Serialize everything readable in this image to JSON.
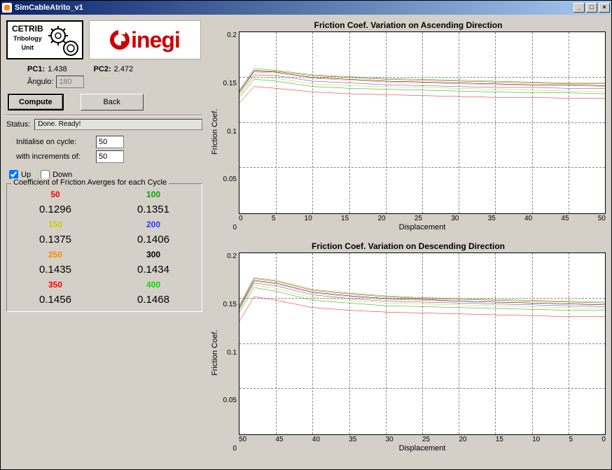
{
  "window": {
    "title": "SimCableAtrito_v1"
  },
  "params": {
    "pc1_label": "PC1:",
    "pc1_value": "1.438",
    "pc2_label": "PC2:",
    "pc2_value": "2.472",
    "angle_label": "Ângulo:",
    "angle_value": "180"
  },
  "buttons": {
    "compute": "Compute",
    "back": "Back"
  },
  "status": {
    "label": "Status:",
    "text": "Done.   Ready!"
  },
  "init": {
    "label1": "Initialise on cycle:",
    "value1": "50",
    "label2": "with increments of:",
    "value2": "50"
  },
  "checks": {
    "up": "Up",
    "down": "Down"
  },
  "cycles": {
    "legend": "Coefficient of Friction Averges for each Cycle",
    "colors": [
      "#ff0000",
      "#00aa00",
      "#cccc00",
      "#3333ff",
      "#ff8800",
      "#000000",
      "#ff0000",
      "#00dd00"
    ],
    "headers": [
      "50",
      "100",
      "150",
      "200",
      "250",
      "300",
      "350",
      "400"
    ],
    "values": [
      "0.1296",
      "0.1351",
      "0.1375",
      "0.1406",
      "0.1435",
      "0.1434",
      "0.1456",
      "0.1468"
    ]
  },
  "chart_data": [
    {
      "type": "line",
      "title": "Friction Coef. Variation on Ascending Direction",
      "xlabel": "Displacement",
      "ylabel": "Friction Coef.",
      "xlim": [
        0,
        50
      ],
      "ylim": [
        0,
        0.2
      ],
      "xticks": [
        0,
        5,
        10,
        15,
        20,
        25,
        30,
        35,
        40,
        45,
        50
      ],
      "yticks": [
        0,
        0.05,
        0.1,
        0.15,
        0.2
      ],
      "x": [
        0,
        2,
        5,
        10,
        15,
        20,
        25,
        30,
        35,
        40,
        45,
        50
      ],
      "series": [
        {
          "name": "50",
          "color": "#ff0000",
          "values": [
            0.122,
            0.14,
            0.138,
            0.134,
            0.132,
            0.131,
            0.13,
            0.129,
            0.128,
            0.128,
            0.127,
            0.127
          ]
        },
        {
          "name": "100",
          "color": "#00aa00",
          "values": [
            0.128,
            0.148,
            0.146,
            0.14,
            0.138,
            0.137,
            0.136,
            0.135,
            0.134,
            0.133,
            0.133,
            0.132
          ]
        },
        {
          "name": "150",
          "color": "#cccc00",
          "values": [
            0.13,
            0.151,
            0.149,
            0.143,
            0.141,
            0.14,
            0.139,
            0.138,
            0.137,
            0.136,
            0.135,
            0.135
          ]
        },
        {
          "name": "200",
          "color": "#3333ff",
          "values": [
            0.132,
            0.153,
            0.152,
            0.146,
            0.144,
            0.142,
            0.141,
            0.14,
            0.139,
            0.139,
            0.138,
            0.138
          ]
        },
        {
          "name": "250",
          "color": "#ff8800",
          "values": [
            0.134,
            0.156,
            0.155,
            0.149,
            0.147,
            0.145,
            0.144,
            0.143,
            0.142,
            0.141,
            0.141,
            0.14
          ]
        },
        {
          "name": "300",
          "color": "#000000",
          "values": [
            0.134,
            0.157,
            0.156,
            0.15,
            0.148,
            0.146,
            0.145,
            0.144,
            0.143,
            0.142,
            0.142,
            0.141
          ]
        },
        {
          "name": "350",
          "color": "#ff0000",
          "values": [
            0.135,
            0.158,
            0.157,
            0.152,
            0.15,
            0.148,
            0.147,
            0.146,
            0.145,
            0.144,
            0.143,
            0.143
          ]
        },
        {
          "name": "400",
          "color": "#00dd00",
          "values": [
            0.136,
            0.16,
            0.158,
            0.153,
            0.151,
            0.149,
            0.148,
            0.147,
            0.146,
            0.145,
            0.144,
            0.144
          ]
        }
      ]
    },
    {
      "type": "line",
      "title": "Friction Coef. Variation on Descending Direction",
      "xlabel": "Displacement",
      "ylabel": "Friction Coef.",
      "xlim_display": [
        50,
        0
      ],
      "ylim": [
        0,
        0.2
      ],
      "xticks": [
        50,
        45,
        40,
        35,
        30,
        25,
        20,
        15,
        10,
        5,
        0
      ],
      "yticks": [
        0,
        0.05,
        0.1,
        0.15,
        0.2
      ],
      "x": [
        50,
        48,
        45,
        40,
        35,
        30,
        25,
        20,
        15,
        10,
        5,
        0
      ],
      "series": [
        {
          "name": "50",
          "color": "#ff0000",
          "values": [
            0.125,
            0.152,
            0.148,
            0.14,
            0.137,
            0.135,
            0.134,
            0.133,
            0.132,
            0.131,
            0.13,
            0.13
          ]
        },
        {
          "name": "100",
          "color": "#00aa00",
          "values": [
            0.135,
            0.162,
            0.158,
            0.148,
            0.145,
            0.142,
            0.141,
            0.14,
            0.139,
            0.138,
            0.137,
            0.137
          ]
        },
        {
          "name": "150",
          "color": "#cccc00",
          "values": [
            0.137,
            0.165,
            0.161,
            0.151,
            0.148,
            0.145,
            0.144,
            0.143,
            0.142,
            0.141,
            0.14,
            0.139
          ]
        },
        {
          "name": "200",
          "color": "#3333ff",
          "values": [
            0.139,
            0.167,
            0.164,
            0.154,
            0.15,
            0.147,
            0.146,
            0.145,
            0.144,
            0.143,
            0.142,
            0.141
          ]
        },
        {
          "name": "250",
          "color": "#ff8800",
          "values": [
            0.14,
            0.169,
            0.166,
            0.156,
            0.152,
            0.149,
            0.148,
            0.147,
            0.146,
            0.145,
            0.144,
            0.143
          ]
        },
        {
          "name": "300",
          "color": "#000000",
          "values": [
            0.14,
            0.17,
            0.167,
            0.157,
            0.153,
            0.15,
            0.149,
            0.147,
            0.146,
            0.145,
            0.144,
            0.143
          ]
        },
        {
          "name": "350",
          "color": "#ff0000",
          "values": [
            0.142,
            0.172,
            0.169,
            0.159,
            0.155,
            0.152,
            0.15,
            0.149,
            0.148,
            0.147,
            0.146,
            0.145
          ]
        },
        {
          "name": "400",
          "color": "#00dd00",
          "values": [
            0.143,
            0.173,
            0.17,
            0.16,
            0.156,
            0.153,
            0.151,
            0.15,
            0.149,
            0.148,
            0.147,
            0.146
          ]
        }
      ]
    }
  ]
}
